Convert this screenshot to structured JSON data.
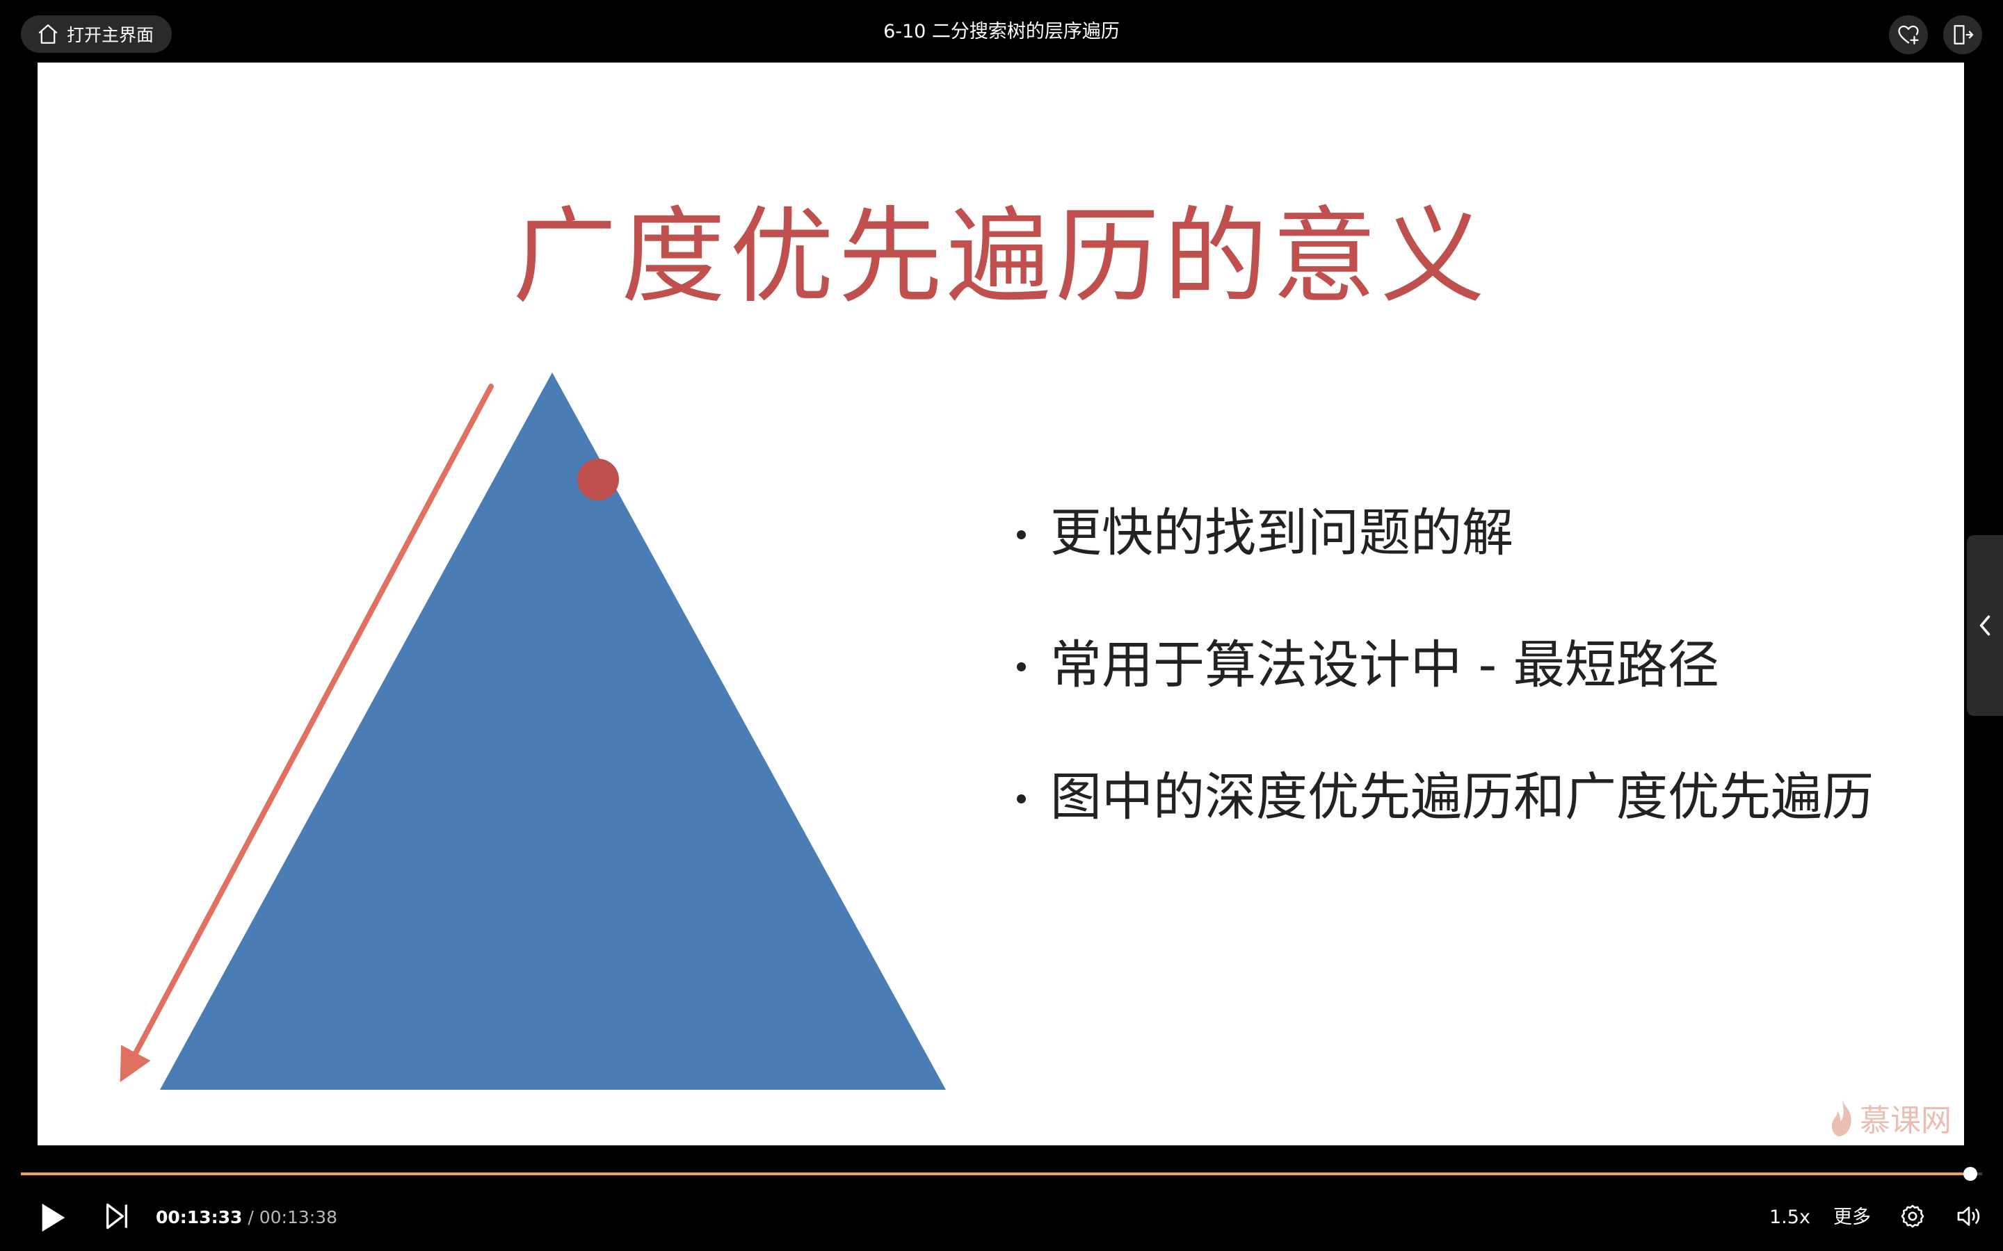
{
  "topbar": {
    "home_label": "打开主界面",
    "video_title": "6-10 二分搜索树的层序遍历",
    "icons": [
      "home-icon",
      "heart-plus-icon",
      "picture-in-picture-icon"
    ]
  },
  "slide": {
    "title": "广度优先遍历的意义",
    "bullets": [
      "更快的找到问题的解",
      "常用于算法设计中 - 最短路径",
      "图中的深度优先遍历和广度优先遍历"
    ],
    "watermark": "慕课网",
    "colors": {
      "title": "#c0504d",
      "triangle": "#4a7db5",
      "dot": "#c0504d",
      "arrow": "#e07060"
    }
  },
  "player": {
    "current_time": "00:13:33",
    "separator": "/",
    "duration": "00:13:38",
    "progress": 0.994,
    "speed_label": "1.5x",
    "more_label": "更多",
    "icons": [
      "play-icon",
      "next-icon",
      "settings-icon",
      "volume-icon",
      "chevron-left-icon"
    ],
    "colors": {
      "progress_fill": "#f0a060",
      "progress_track": "#4a3a30"
    }
  }
}
